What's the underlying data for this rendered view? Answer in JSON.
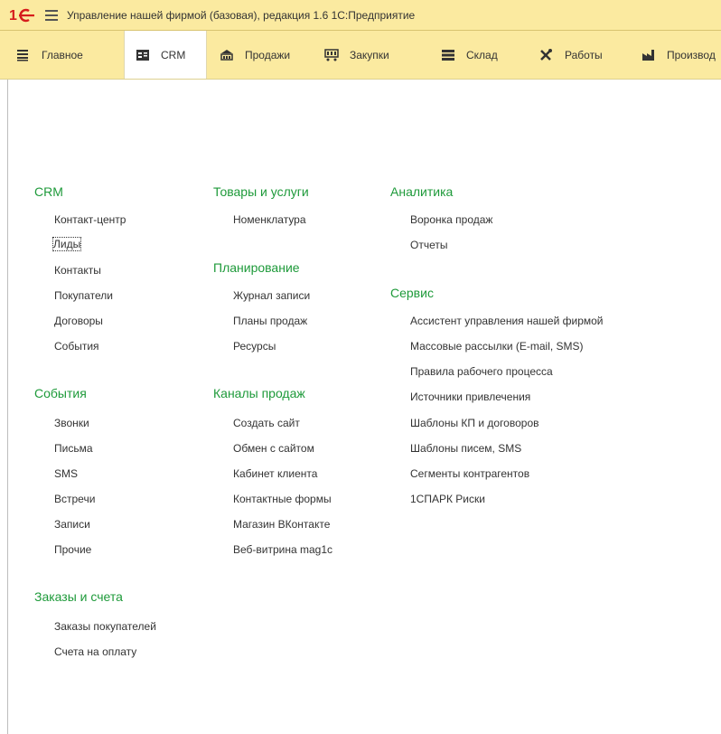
{
  "window": {
    "title": "Управление нашей фирмой (базовая), редакция 1.6 1С:Предприятие"
  },
  "sections": [
    {
      "label": "Главное",
      "icon": "menu-lines-icon"
    },
    {
      "label": "CRM",
      "icon": "contact-card-icon"
    },
    {
      "label": "Продажи",
      "icon": "cash-register-icon"
    },
    {
      "label": "Закупки",
      "icon": "shopping-cart-icon"
    },
    {
      "label": "Склад",
      "icon": "warehouse-icon"
    },
    {
      "label": "Работы",
      "icon": "tools-icon"
    },
    {
      "label": "Производ",
      "icon": "factory-icon"
    }
  ],
  "active_section": "CRM",
  "columns": {
    "col1": {
      "groups": [
        {
          "title": "CRM",
          "items": [
            "Контакт-центр",
            "Лиды",
            "Контакты",
            "Покупатели",
            "Договоры",
            "События"
          ]
        },
        {
          "title": "События",
          "items": [
            "Звонки",
            "Письма",
            "SMS",
            "Встречи",
            "Записи",
            "Прочие"
          ]
        },
        {
          "title": "Заказы и счета",
          "items": [
            "Заказы покупателей",
            "Счета на оплату"
          ]
        }
      ]
    },
    "col2": {
      "groups": [
        {
          "title": "Товары и услуги",
          "items": [
            "Номенклатура"
          ]
        },
        {
          "title": "Планирование",
          "items": [
            "Журнал записи",
            "Планы продаж",
            "Ресурсы"
          ]
        },
        {
          "title": "Каналы продаж",
          "items": [
            "Создать сайт",
            "Обмен с сайтом",
            "Кабинет клиента",
            "Контактные формы",
            "Магазин ВКонтакте",
            "Веб-витрина mag1c"
          ]
        }
      ]
    },
    "col3": {
      "groups": [
        {
          "title": "Аналитика",
          "items": [
            "Воронка продаж",
            "Отчеты"
          ]
        },
        {
          "title": "Сервис",
          "items": [
            "Ассистент управления нашей фирмой",
            "Массовые рассылки (E-mail, SMS)",
            "Правила рабочего процесса",
            "Источники привлечения",
            "Шаблоны КП и договоров",
            "Шаблоны писем, SMS",
            "Сегменты контрагентов",
            "1СПАРК Риски"
          ]
        }
      ]
    }
  },
  "focused_item": "Лиды",
  "colors": {
    "accent": "#1e9a3a",
    "bar": "#fbeaa0",
    "logo": "#d61c1c"
  }
}
